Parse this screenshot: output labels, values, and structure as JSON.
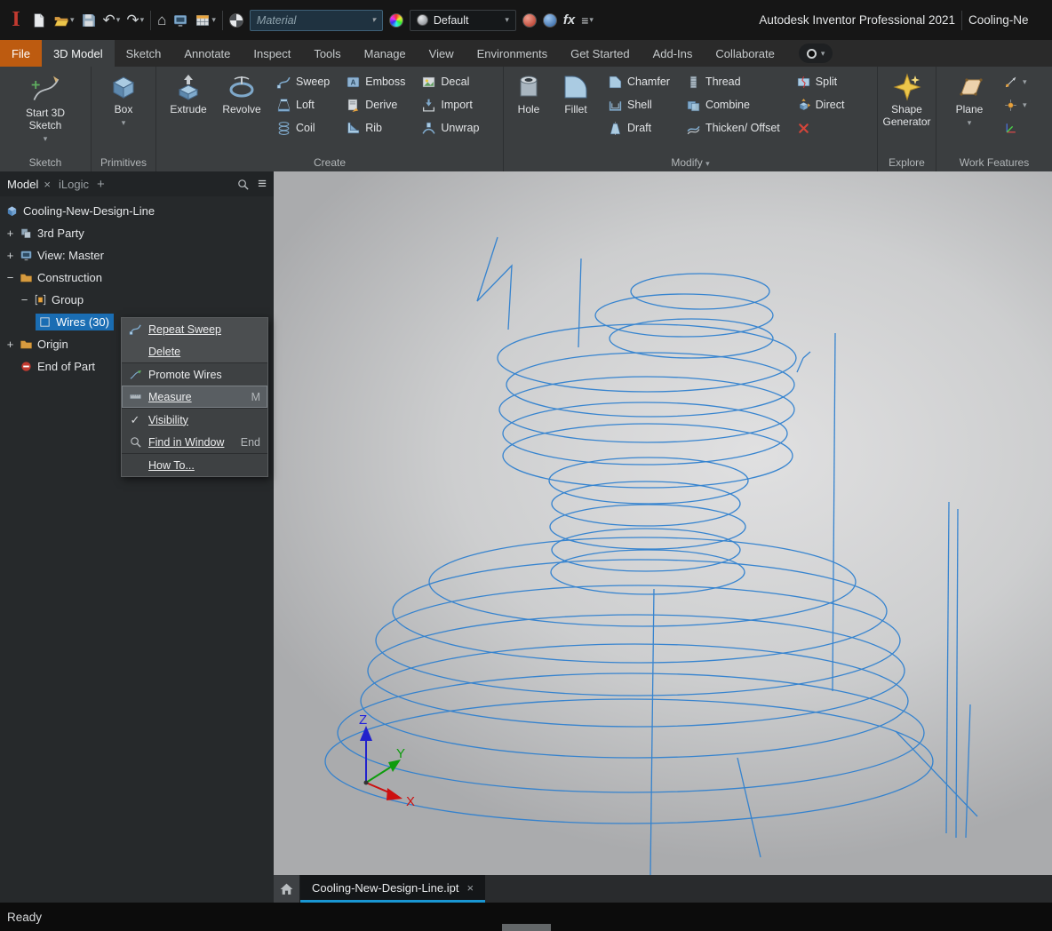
{
  "ui": {
    "caret": "▾",
    "close": "×",
    "check": "✓",
    "home_glyph": "⌂",
    "menu": "≡",
    "undo": "↶",
    "redo": "↷",
    "fx": "fx",
    "plus": "+",
    "logo": "I"
  },
  "titlebar": {
    "material_combo": "Material",
    "appearance_combo": "Default",
    "app_title": "Autodesk Inventor Professional 2021",
    "doc_title": "Cooling-Ne"
  },
  "ribbon": {
    "tabs": [
      "File",
      "3D Model",
      "Sketch",
      "Annotate",
      "Inspect",
      "Tools",
      "Manage",
      "View",
      "Environments",
      "Get Started",
      "Add-Ins",
      "Collaborate"
    ],
    "panels": {
      "sketch": {
        "label": "Sketch",
        "start_button": "Start 3D Sketch"
      },
      "primitives": {
        "label": "Primitives",
        "box_button": "Box"
      },
      "create": {
        "label": "Create",
        "extrude": "Extrude",
        "revolve": "Revolve",
        "small": [
          "Sweep",
          "Loft",
          "Coil",
          "Emboss",
          "Derive",
          "Rib",
          "Decal",
          "Import",
          "Unwrap"
        ]
      },
      "modify": {
        "label": "Modify",
        "hole": "Hole",
        "fillet": "Fillet",
        "small": [
          "Chamfer",
          "Shell",
          "Draft",
          "Thread",
          "Combine",
          "Thicken/ Offset",
          "Split",
          "Direct"
        ]
      },
      "explore": {
        "label": "Explore",
        "shape_generator": "Shape Generator"
      },
      "work_features": {
        "label": "Work Features",
        "plane": "Plane"
      }
    }
  },
  "browser": {
    "tab_model": "Model",
    "tab_ilogic": "iLogic",
    "tree": [
      {
        "label": "Cooling-New-Design-Line",
        "expander": ""
      },
      {
        "label": "3rd Party",
        "expander": "+"
      },
      {
        "label": "View: Master",
        "expander": "+"
      },
      {
        "label": "Construction",
        "expander": "−"
      },
      {
        "label": "Group",
        "expander": "−"
      },
      {
        "label": "Wires (30)",
        "expander": ""
      },
      {
        "label": "Origin",
        "expander": "+"
      },
      {
        "label": "End of Part",
        "expander": ""
      }
    ]
  },
  "context_menu": {
    "items": [
      {
        "label": "Repeat Sweep",
        "shortcut": ""
      },
      {
        "label": "Delete",
        "shortcut": ""
      },
      {
        "label": "Promote Wires",
        "shortcut": ""
      },
      {
        "label": "Measure",
        "shortcut": "M"
      },
      {
        "label": "Visibility",
        "shortcut": ""
      },
      {
        "label": "Find in Window",
        "shortcut": "End"
      },
      {
        "label": "How To...",
        "shortcut": ""
      }
    ]
  },
  "viewport": {
    "triad": {
      "x": "X",
      "y": "Y",
      "z": "Z"
    }
  },
  "doc_tab": {
    "label": "Cooling-New-Design-Line.ipt"
  },
  "statusbar": {
    "text": "Ready"
  },
  "colors": {
    "accent_blue": "#1c97d4",
    "selection_blue": "#1a6db3",
    "wireframe_blue": "#2f80cf",
    "file_tab_orange": "#bd5b10"
  }
}
